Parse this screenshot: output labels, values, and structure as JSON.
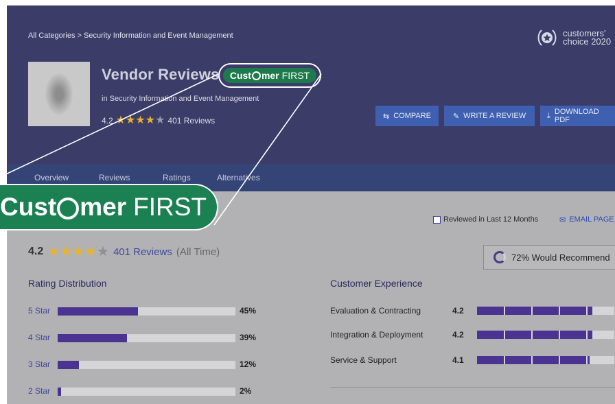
{
  "breadcrumb": "All Categories > Security Information and Event Management",
  "badge": {
    "line1": "customers'",
    "line2": "choice 2020"
  },
  "vendor": {
    "title": "Vendor Reviews",
    "category": "in Security Information and Event Management",
    "rating": "4.2",
    "stars_filled": 4,
    "reviews": "401 Reviews"
  },
  "customer_first": {
    "bold": "Cust",
    "bold2": "mer",
    "light": "FIRST"
  },
  "actions": {
    "compare": "COMPARE",
    "write_review": "WRITE A REVIEW",
    "download": "DOWNLOAD PDF"
  },
  "nav": [
    "Overview",
    "Reviews",
    "Ratings",
    "Alternatives"
  ],
  "overall": {
    "rating": "4.2",
    "reviews_link": "401 Reviews",
    "period": "(All Time)"
  },
  "filter": {
    "label": "Reviewed in Last 12 Months",
    "email": "EMAIL PAGE"
  },
  "recommend": {
    "text": "72% Would Recommend",
    "value": 0.72
  },
  "distribution": {
    "title": "Rating Distribution",
    "rows": [
      {
        "label": "5 Star",
        "pct_text": "45%",
        "pct": 45
      },
      {
        "label": "4 Star",
        "pct_text": "39%",
        "pct": 39
      },
      {
        "label": "3 Star",
        "pct_text": "12%",
        "pct": 12
      },
      {
        "label": "2 Star",
        "pct_text": "2%",
        "pct": 2
      }
    ]
  },
  "experience": {
    "title": "Customer Experience",
    "rows": [
      {
        "label": "Evaluation & Contracting",
        "value": "4.2",
        "score": 4.2
      },
      {
        "label": "Integration & Deployment",
        "value": "4.2",
        "score": 4.2
      },
      {
        "label": "Service & Support",
        "value": "4.1",
        "score": 4.1
      }
    ]
  },
  "colors": {
    "hero": "#3b3c68",
    "nav": "#354476",
    "accent_green": "#1b8052",
    "bar": "#4a3391",
    "button": "#3f5fb0",
    "star": "#e9b429"
  }
}
